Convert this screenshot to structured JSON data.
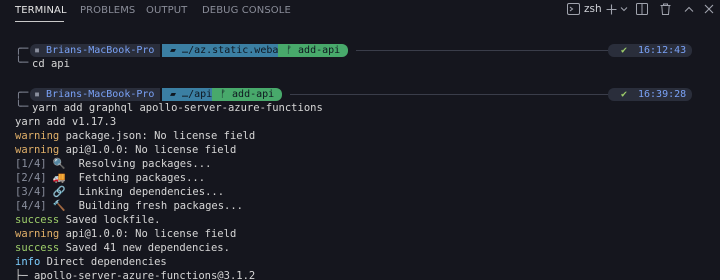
{
  "tabs": [
    {
      "label": "TERMINAL",
      "active": true
    },
    {
      "label": "PROBLEMS",
      "active": false
    },
    {
      "label": "OUTPUT",
      "active": false
    },
    {
      "label": "DEBUG CONSOLE",
      "active": false
    }
  ],
  "toolbar": {
    "shell_label": "zsh",
    "icons": [
      "terminal-icon",
      "plus-icon",
      "chevron-down-icon",
      "split-icon",
      "trash-icon",
      "chevron-up-icon",
      "close-icon"
    ]
  },
  "prompts": [
    {
      "host": "Brians-MacBook-Pro",
      "dir": "…/az.static.webapp",
      "git": "add-api",
      "status": "✔",
      "time": "16:12:43",
      "command": "cd api"
    },
    {
      "host": "Brians-MacBook-Pro",
      "dir": "…/api",
      "git": "add-api",
      "status": "✔",
      "time": "16:39:28",
      "command": "yarn add graphql apollo-server-azure-functions"
    }
  ],
  "output": [
    {
      "prefix": "",
      "text": "yarn add v1.17.3"
    },
    {
      "prefix": "warning",
      "text": " package.json: No license field"
    },
    {
      "prefix": "warning",
      "text": " api@1.0.0: No license field"
    },
    {
      "prefix": "[1/4]",
      "text": " 🔍  Resolving packages..."
    },
    {
      "prefix": "[2/4]",
      "text": " 🚚  Fetching packages..."
    },
    {
      "prefix": "[3/4]",
      "text": " 🔗  Linking dependencies..."
    },
    {
      "prefix": "[4/4]",
      "text": " 🔨  Building fresh packages..."
    },
    {
      "prefix": "success",
      "text": " Saved lockfile."
    },
    {
      "prefix": "warning",
      "text": " api@1.0.0: No license field"
    },
    {
      "prefix": "success",
      "text": " Saved 41 new dependencies."
    },
    {
      "prefix": "info",
      "text": " Direct dependencies"
    },
    {
      "prefix": "├─",
      "text": " apollo-server-azure-functions@3.1.2"
    }
  ],
  "colors": {
    "background": "#15161e",
    "warning": "#e0af68",
    "success": "#9ece6a",
    "info": "#7dcfff",
    "dir_segment": "#3b7fa3",
    "git_segment": "#48a96b"
  }
}
